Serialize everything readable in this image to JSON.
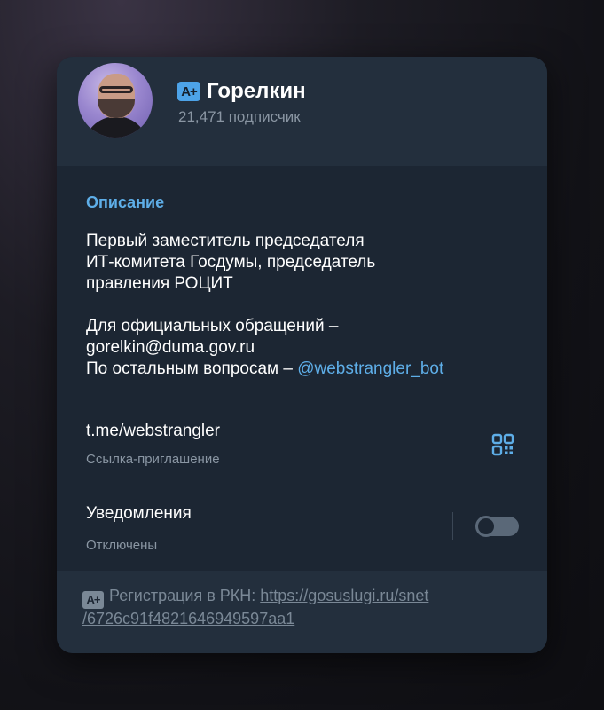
{
  "channel": {
    "badge": "A+",
    "title": "Горелкин",
    "subscribers": "21,471 подписчик"
  },
  "description": {
    "label": "Описание",
    "line1": "Первый заместитель председателя",
    "line2": "ИТ-комитета Госдумы, председатель",
    "line3": "правления РОЦИТ",
    "line4": "Для официальных обращений –",
    "line5": "gorelkin@duma.gov.ru",
    "line6_prefix": "По остальным вопросам – ",
    "line6_mention": "@webstrangler_bot"
  },
  "invite": {
    "link": "t.me/webstrangler",
    "label": "Ссылка-приглашение"
  },
  "notifications": {
    "label": "Уведомления",
    "state": "Отключены",
    "enabled": false
  },
  "footer": {
    "badge": "A+",
    "prefix": "Регистрация в РКН: ",
    "url_line1": "https://gosuslugi.ru/snet",
    "url_line2": "/6726c91f4821646949597aa1"
  },
  "colors": {
    "accent": "#5eaee8",
    "card": "#1c2633",
    "header": "#232f3d",
    "muted": "#8a96a3"
  }
}
